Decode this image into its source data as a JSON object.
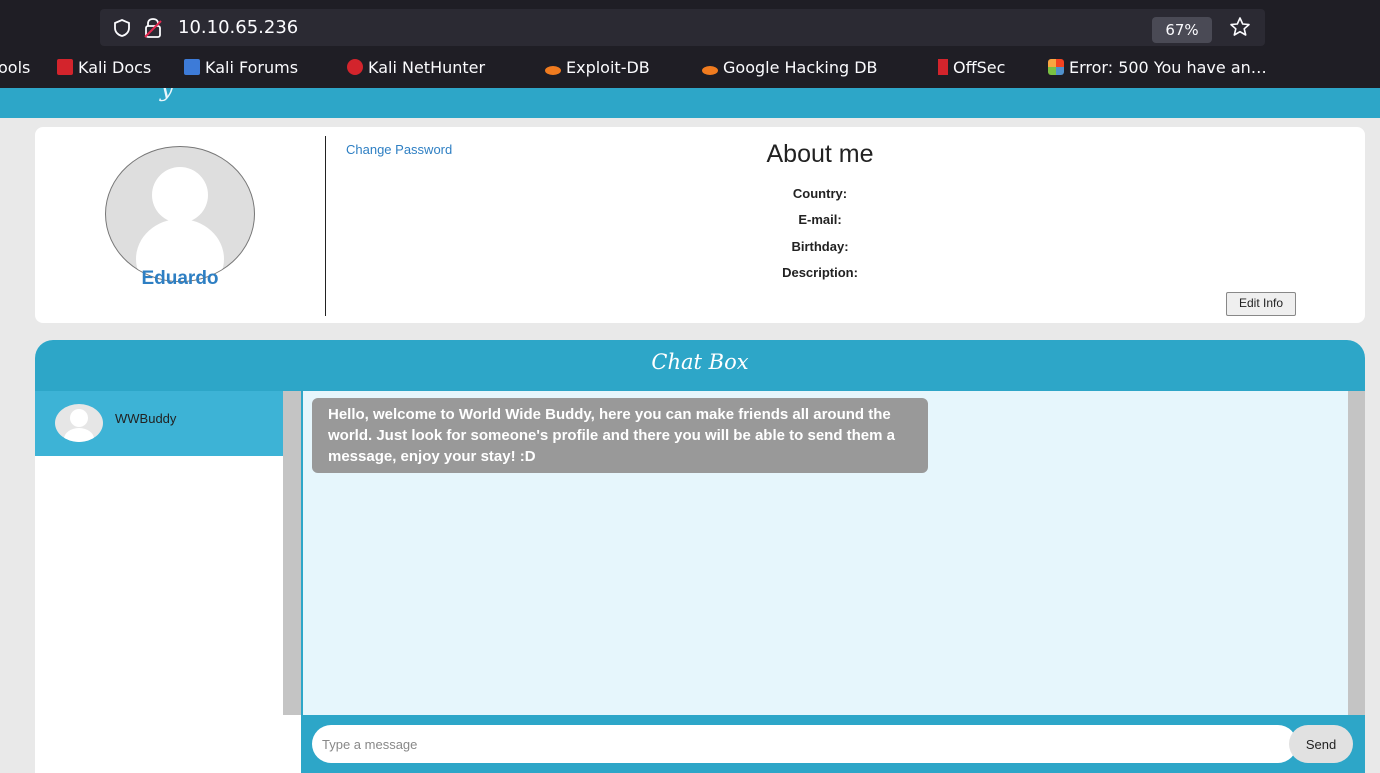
{
  "browser": {
    "url": "10.10.65.236",
    "zoom": "67%",
    "bookmarks": [
      {
        "label": "ools",
        "icon": "tools-icon"
      },
      {
        "label": "Kali Docs",
        "icon": "kali-docs-icon"
      },
      {
        "label": "Kali Forums",
        "icon": "kali-forums-icon"
      },
      {
        "label": "Kali NetHunter",
        "icon": "kali-nethunter-icon"
      },
      {
        "label": "Exploit-DB",
        "icon": "exploit-db-icon"
      },
      {
        "label": "Google Hacking DB",
        "icon": "google-hacking-db-icon"
      },
      {
        "label": "OffSec",
        "icon": "offsec-icon"
      },
      {
        "label": "Error: 500 You have an…",
        "icon": "joomla-icon"
      }
    ]
  },
  "profile": {
    "name": "Eduardo",
    "change_password": "Change Password",
    "about_title": "About me",
    "fields": {
      "country": "Country:",
      "email": "E-mail:",
      "birthday": "Birthday:",
      "description": "Description:"
    },
    "edit_info": "Edit Info"
  },
  "chat": {
    "title": "Chat Box",
    "contacts": [
      {
        "name": "WWBuddy"
      }
    ],
    "messages": [
      {
        "text": "Hello, welcome to World Wide Buddy, here you can make friends all around the world. Just look for someone's profile and there you will be able to send them a message, enjoy your stay! :D"
      }
    ],
    "input_placeholder": "Type a message",
    "send_label": "Send"
  },
  "colors": {
    "accent": "#2da6c8",
    "selected_contact": "#3db3d6",
    "link": "#2e7fc3",
    "message_bubble": "#999999",
    "messages_bg": "#e6f6fc"
  }
}
